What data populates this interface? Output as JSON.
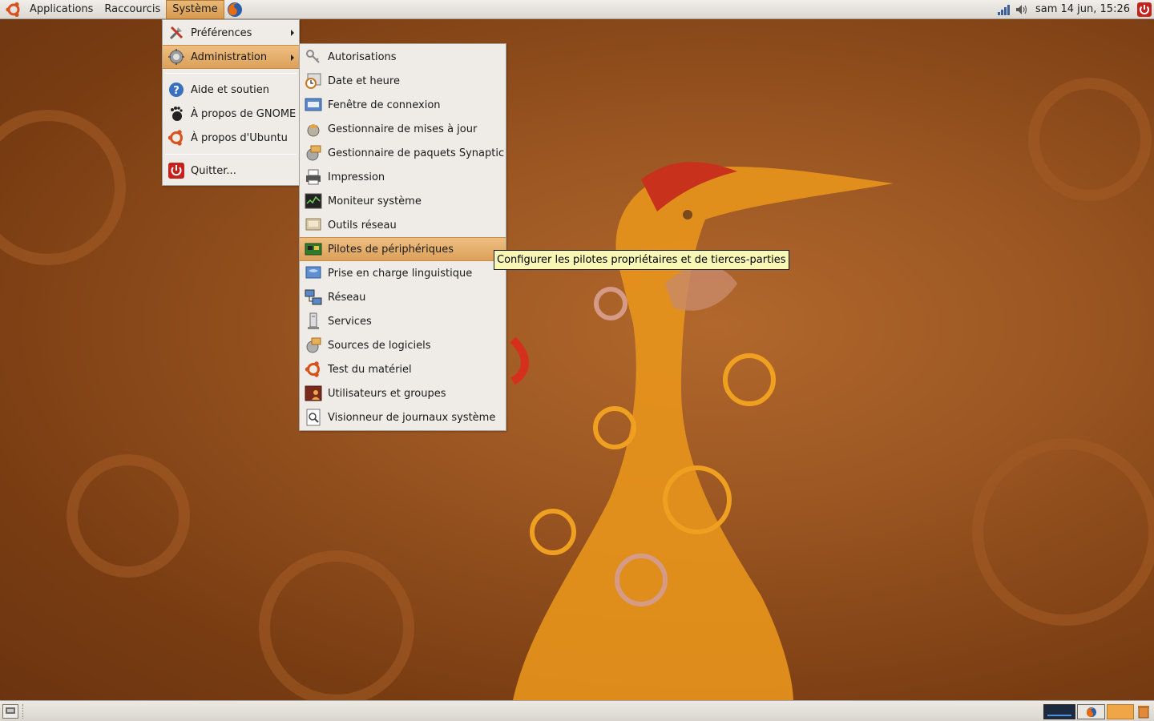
{
  "top_panel": {
    "menus": {
      "applications": "Applications",
      "places": "Raccourcis",
      "system": "Système"
    },
    "clock": "sam 14 jun, 15:26"
  },
  "system_menu": {
    "items": [
      {
        "label": "Préférences",
        "icon": "preferences-icon",
        "submenu": true
      },
      {
        "label": "Administration",
        "icon": "administration-gear-icon",
        "submenu": true,
        "selected": true
      },
      {
        "label": "Aide et soutien",
        "icon": "help-icon"
      },
      {
        "label": "À propos de GNOME",
        "icon": "gnome-foot-icon"
      },
      {
        "label": "À propos d'Ubuntu",
        "icon": "ubuntu-logo-icon"
      },
      {
        "label": "Quitter...",
        "icon": "power-icon"
      }
    ]
  },
  "admin_menu": {
    "items": [
      {
        "label": "Autorisations",
        "icon": "keys-icon"
      },
      {
        "label": "Date et heure",
        "icon": "clock-icon"
      },
      {
        "label": "Fenêtre de connexion",
        "icon": "login-window-icon"
      },
      {
        "label": "Gestionnaire de mises à jour",
        "icon": "update-manager-icon"
      },
      {
        "label": "Gestionnaire de paquets Synaptic",
        "icon": "synaptic-icon"
      },
      {
        "label": "Impression",
        "icon": "printer-icon"
      },
      {
        "label": "Moniteur système",
        "icon": "system-monitor-icon"
      },
      {
        "label": "Outils réseau",
        "icon": "network-tools-icon"
      },
      {
        "label": "Pilotes de périphériques",
        "icon": "hardware-drivers-icon",
        "selected": true
      },
      {
        "label": "Prise en charge linguistique",
        "icon": "language-flag-icon"
      },
      {
        "label": "Réseau",
        "icon": "network-icon"
      },
      {
        "label": "Services",
        "icon": "services-icon"
      },
      {
        "label": "Sources de logiciels",
        "icon": "software-sources-icon"
      },
      {
        "label": "Test du matériel",
        "icon": "hardware-test-icon"
      },
      {
        "label": "Utilisateurs et groupes",
        "icon": "users-groups-icon"
      },
      {
        "label": "Visionneur de journaux système",
        "icon": "log-viewer-icon"
      }
    ]
  },
  "tooltip": "Configurer les pilotes propriétaires et de tierces-parties",
  "colors": {
    "selection": "#dca05a",
    "panel": "#e6e2dc",
    "tooltip_bg": "#f8f7b6",
    "wallpaper": "#9b5622"
  }
}
